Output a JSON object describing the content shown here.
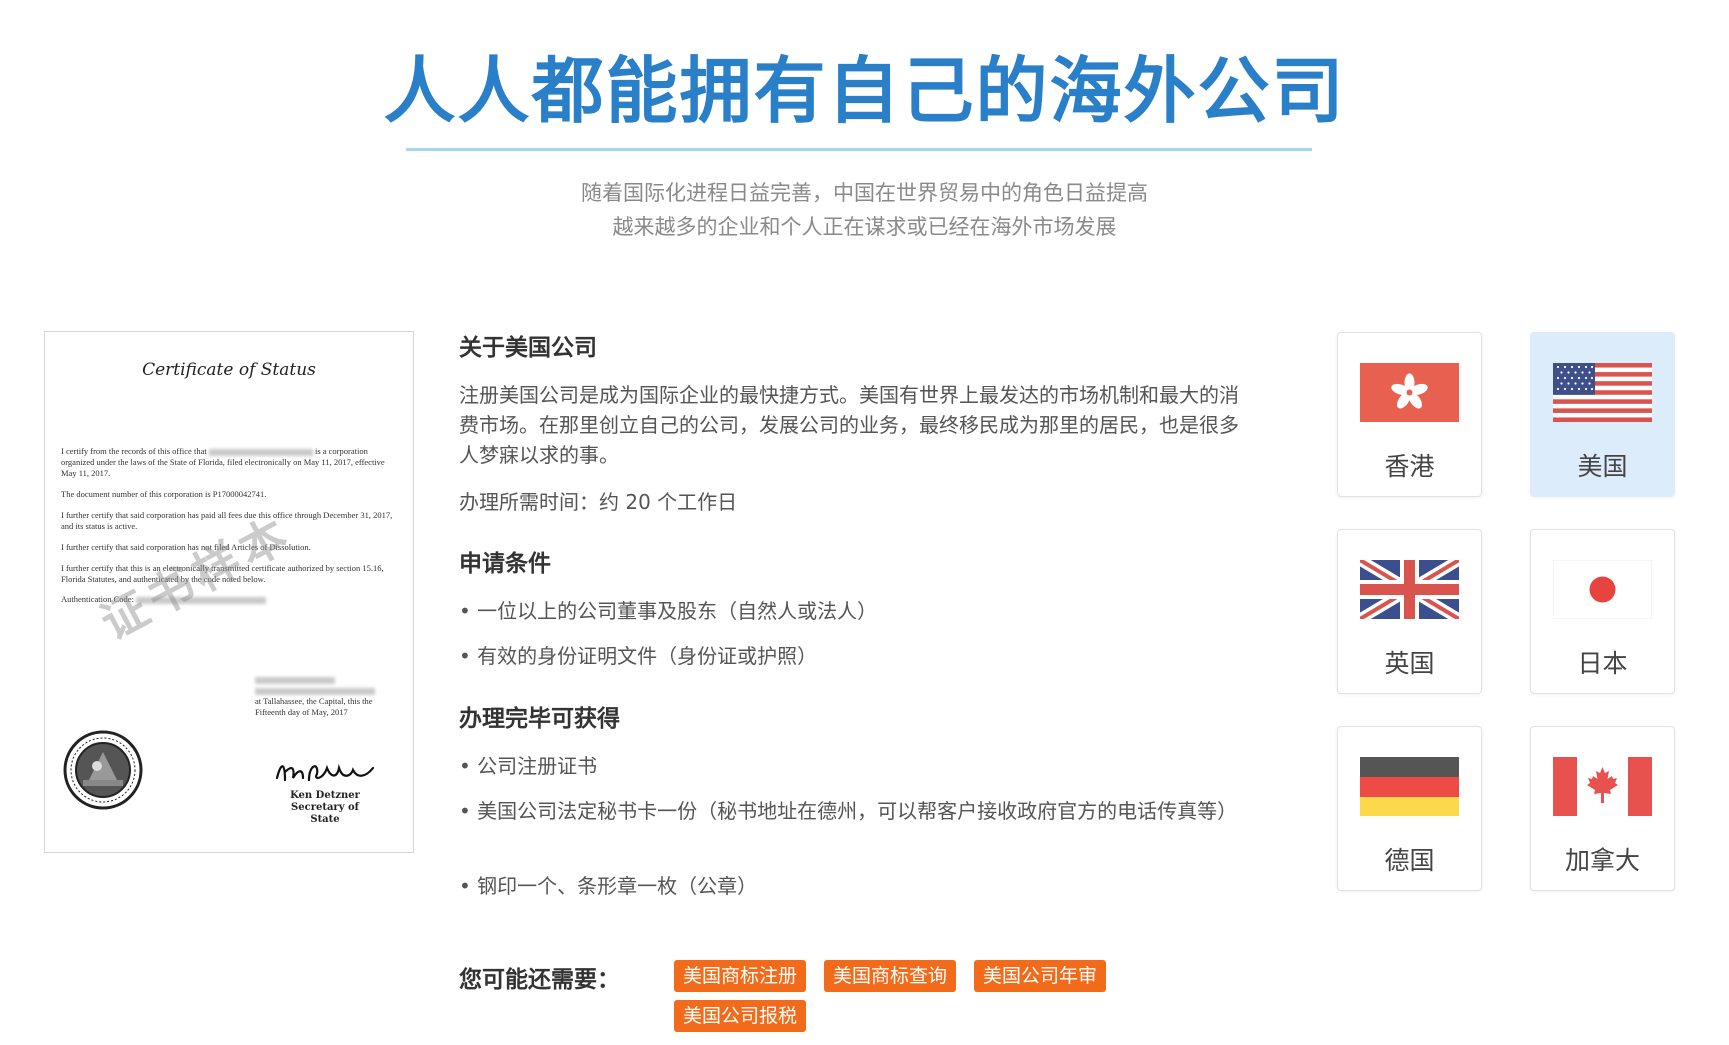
{
  "hero": {
    "title": "人人都能拥有自己的海外公司",
    "subtitle_line1": "随着国际化进程日益完善，中国在世界贸易中的角色日益提高",
    "subtitle_line2": "越来越多的企业和个人正在谋求或已经在海外市场发展"
  },
  "certificate": {
    "title": "Certificate of Status",
    "para1_prefix": "I certify from the records of this office that",
    "para1_suffix": "is a corporation organized under the laws of the State of Florida, filed electronically on May 11, 2017, effective    May 11, 2017.",
    "para2": "The document number of this corporation is P17000042741.",
    "para3": "I further certify that said corporation has paid all fees due this office through December 31, 2017, and its status is active.",
    "para4": "I further certify that said corporation has not filed Articles of Dissolution.",
    "para5": "I further certify that this is an electronically transmitted certificate authorized by section 15.16, Florida Statutes, and authenticated by the code noted below.",
    "auth_label": "Authentication Code:",
    "given_line3": "at Tallahassee, the Capital, this the",
    "given_line4": "Fifteenth day of May, 2017",
    "signer_name": "Ken Detzner",
    "signer_title": "Secretary of State",
    "watermark": "证书样本"
  },
  "about": {
    "title": "关于美国公司",
    "description": "注册美国公司是成为国际企业的最快捷方式。美国有世界上最发达的市场机制和最大的消费市场。在那里创立自己的公司，发展公司的业务，最终移民成为那里的居民，也是很多人梦寐以求的事。",
    "time_text": "办理所需时间：约 20 个工作日"
  },
  "requirements": {
    "title": "申请条件",
    "items": [
      "• 一位以上的公司董事及股东（自然人或法人）",
      "• 有效的身份证明文件（身份证或护照）"
    ]
  },
  "deliverables": {
    "title": "办理完毕可获得",
    "items": [
      "• 公司注册证书",
      "• 美国公司法定秘书卡一份（秘书地址在德州，可以帮客户接收政府官方的电话传真等）",
      "• 钢印一个、条形章一枚（公章）"
    ]
  },
  "related": {
    "label": "您可能还需要：",
    "tags": [
      "美国商标注册",
      "美国商标查询",
      "美国公司年审",
      "美国公司报税"
    ]
  },
  "countries": [
    {
      "name": "香港",
      "flag_icon": "hong-kong-flag-icon",
      "active": false
    },
    {
      "name": "美国",
      "flag_icon": "usa-flag-icon",
      "active": true
    },
    {
      "name": "英国",
      "flag_icon": "uk-flag-icon",
      "active": false
    },
    {
      "name": "日本",
      "flag_icon": "japan-flag-icon",
      "active": false
    },
    {
      "name": "德国",
      "flag_icon": "germany-flag-icon",
      "active": false
    },
    {
      "name": "加拿大",
      "flag_icon": "canada-flag-icon",
      "active": false
    }
  ],
  "colors": {
    "title_blue": "#2a7fc9",
    "tag_orange": "#f26b1a",
    "active_card": "#dcecfb"
  }
}
